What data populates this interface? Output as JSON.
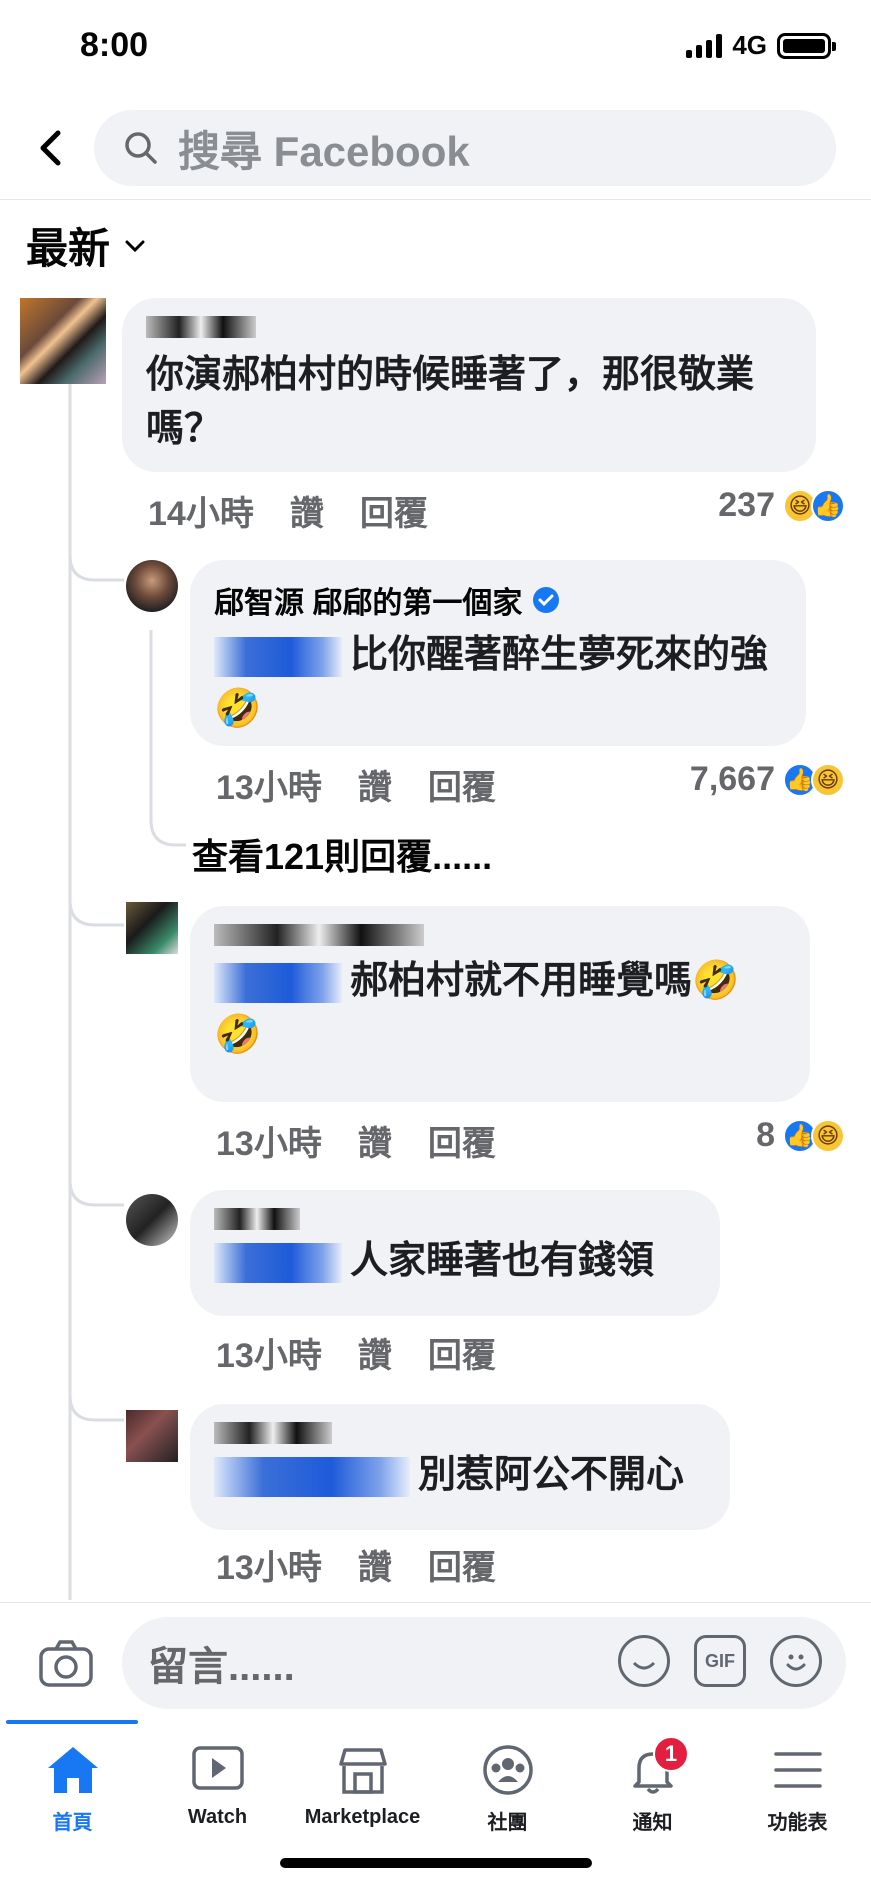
{
  "status": {
    "time": "8:00",
    "network": "4G"
  },
  "search": {
    "placeholder": "搜尋 Facebook"
  },
  "sort": {
    "label": "最新"
  },
  "comments": [
    {
      "text": "你演郝柏村的時候睡著了，那很敬業嗎？",
      "time": "14小時",
      "like": "讚",
      "reply": "回覆",
      "count": "237"
    },
    {
      "name": "郈智源 郈郈的第一個家",
      "text": "比你醒著醉生夢死來的強🤣",
      "time": "13小時",
      "like": "讚",
      "reply": "回覆",
      "count": "7,667"
    },
    {
      "text": "郝柏村就不用睡覺嗎🤣🤣",
      "time": "13小時",
      "like": "讚",
      "reply": "回覆",
      "count": "8"
    },
    {
      "text": "人家睡著也有錢領",
      "time": "13小時",
      "like": "讚",
      "reply": "回覆"
    },
    {
      "text": "別惹阿公不開心",
      "time": "13小時",
      "like": "讚",
      "reply": "回覆"
    }
  ],
  "view_replies": "查看121則回覆......",
  "composer": {
    "placeholder": "留言......",
    "gif": "GIF"
  },
  "tabs": [
    {
      "label": "首頁"
    },
    {
      "label": "Watch"
    },
    {
      "label": "Marketplace"
    },
    {
      "label": "社團"
    },
    {
      "label": "通知",
      "badge": "1"
    },
    {
      "label": "功能表"
    }
  ],
  "colors": {
    "accent": "#1877f2",
    "bubble": "#f0f2f5",
    "badge": "#e41e3f"
  }
}
